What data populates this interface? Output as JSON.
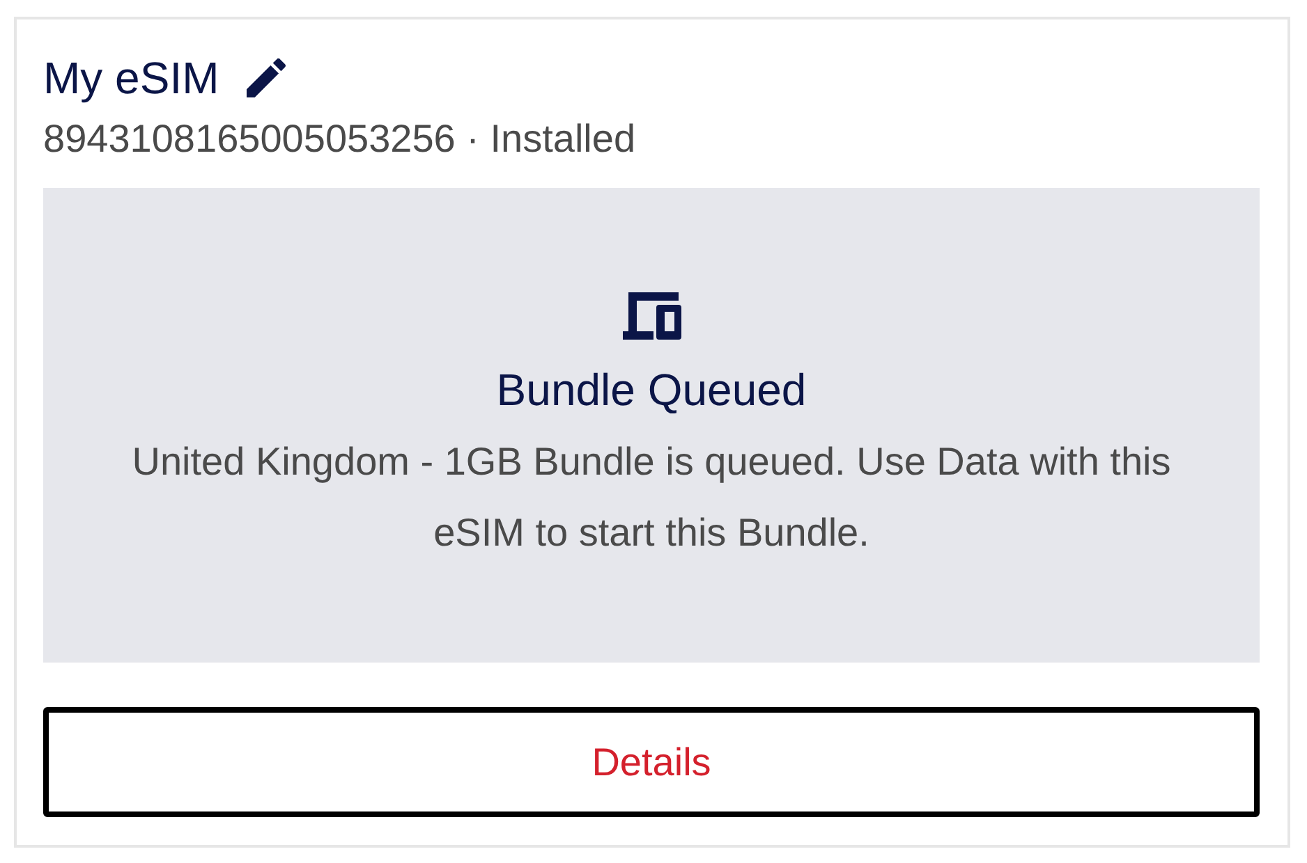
{
  "card": {
    "title": "My eSIM",
    "subtitle": "8943108165005053256 · Installed"
  },
  "status_panel": {
    "title": "Bundle Queued",
    "message": "United Kingdom - 1GB Bundle is queued. Use Data with this eSIM to start this Bundle."
  },
  "button": {
    "label": "Details",
    "focused": true
  }
}
